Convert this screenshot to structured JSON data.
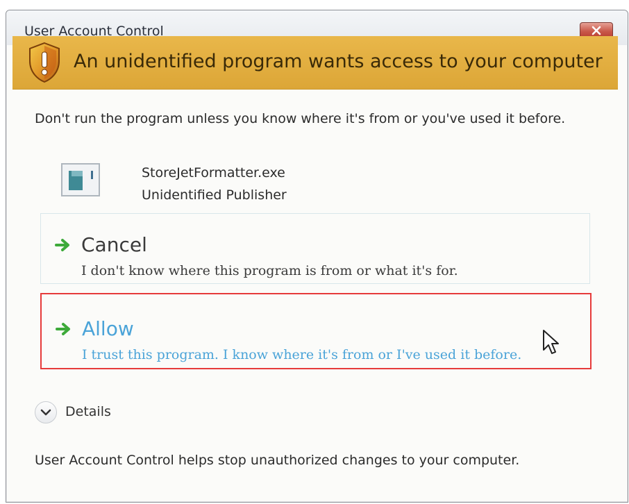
{
  "window": {
    "title": "User Account Control"
  },
  "banner": {
    "headline": "An unidentified program wants access to your computer",
    "color": "#e2ad3f"
  },
  "message": {
    "warning": "Don't run the program unless you know where it's from or you've used it before."
  },
  "program": {
    "name": "StoreJetFormatter.exe",
    "publisher": "Unidentified Publisher",
    "icon": "program-icon"
  },
  "options": {
    "cancel": {
      "label": "Cancel",
      "description": "I don't know where this program is from or what it's for.",
      "icon": "green-arrow-icon"
    },
    "allow": {
      "label": "Allow",
      "description": "I trust this program. I know where it's from or I've used it before.",
      "icon": "green-arrow-icon",
      "highlight_color": "#e63a3a",
      "text_color": "#4aa3d8"
    }
  },
  "details": {
    "label": "Details"
  },
  "footer": {
    "text": "User Account Control helps stop unauthorized changes to your computer."
  }
}
